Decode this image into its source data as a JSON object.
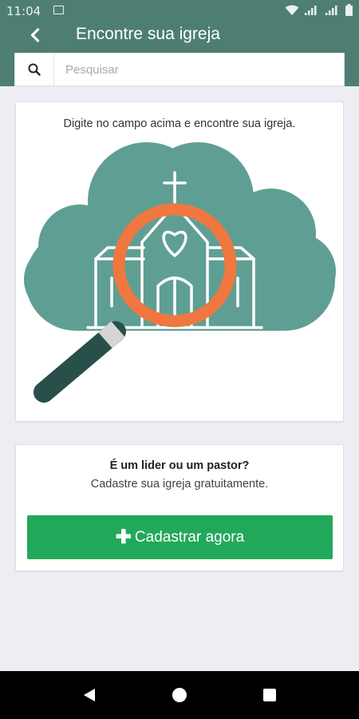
{
  "status_bar": {
    "time": "11:04"
  },
  "header": {
    "title": "Encontre sua igreja",
    "back_icon": "chevron-left-icon"
  },
  "search": {
    "placeholder": "Pesquisar",
    "value": "",
    "icon": "search-icon"
  },
  "info_card": {
    "text": "Digite no campo acima e encontre sua igreja.",
    "illustration": "church-magnifier-illustration"
  },
  "register_card": {
    "title": "É um lider ou um pastor?",
    "subtitle": "Cadastre sua igreja gratuitamente.",
    "button_label": "Cadastrar agora",
    "button_icon": "plus-icon"
  },
  "nav": {
    "icons": [
      "back-triangle-icon",
      "home-circle-icon",
      "recents-square-icon"
    ]
  },
  "colors": {
    "primary": "#4e7e73",
    "cloud": "#5f9f93",
    "accent_orange": "#f0773f",
    "handle_dark": "#294f4b",
    "button_green": "#22a85a",
    "background": "#eceef4"
  }
}
